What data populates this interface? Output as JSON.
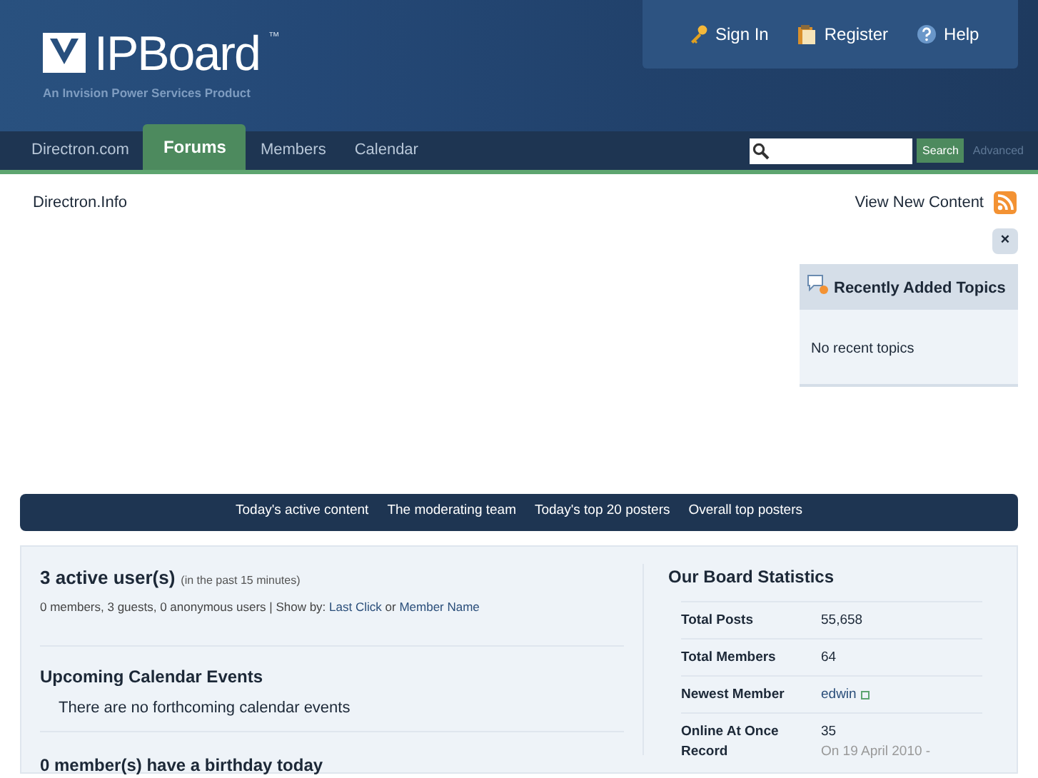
{
  "header": {
    "logo": {
      "name": "IPBoard",
      "mark": "™",
      "tagline": "An Invision Power Services Product"
    },
    "user_links": [
      {
        "label": "Sign In",
        "kind": "key"
      },
      {
        "label": "Register",
        "kind": "clipboard"
      },
      {
        "label": "Help",
        "kind": "help"
      }
    ]
  },
  "nav": {
    "tabs": [
      {
        "label": "Directron.com",
        "selected": false
      },
      {
        "label": "Forums",
        "selected": true
      },
      {
        "label": "Members",
        "selected": false
      },
      {
        "label": "Calendar",
        "selected": false
      }
    ],
    "search": {
      "button": "Search",
      "advanced": "Advanced"
    }
  },
  "breadcrumb": "Directron.Info",
  "view_new_content": "View New Content",
  "sidebar": {
    "close": "×",
    "block": {
      "title": "Recently Added Topics",
      "text": "No recent topics"
    }
  },
  "stats_links": [
    "Today's active content",
    "The moderating team",
    "Today's top 20 posters",
    "Overall top posters"
  ],
  "active_users": {
    "title": "3 active user(s)",
    "note": "(in the past 15 minutes)",
    "summary": "0 members, 3 guests, 0 anonymous users | Show by:",
    "links": [
      "Last Click",
      "Member Name"
    ],
    "joiner": "or"
  },
  "calendar": {
    "title": "Upcoming Calendar Events",
    "text": "There are no forthcoming calendar events"
  },
  "birthdays": {
    "title": "0 member(s) have a birthday today"
  },
  "board_stats": {
    "title": "Our Board Statistics",
    "rows": [
      {
        "label": "Total Posts",
        "value": "55,658",
        "kind": "text"
      },
      {
        "label": "Total Members",
        "value": "64",
        "kind": "text"
      },
      {
        "label": "Newest Member",
        "value": "edwin",
        "kind": "link"
      },
      {
        "label": "Online At Once Record",
        "value": "35",
        "note": "On 19 April 2010 -",
        "kind": "record"
      }
    ]
  }
}
